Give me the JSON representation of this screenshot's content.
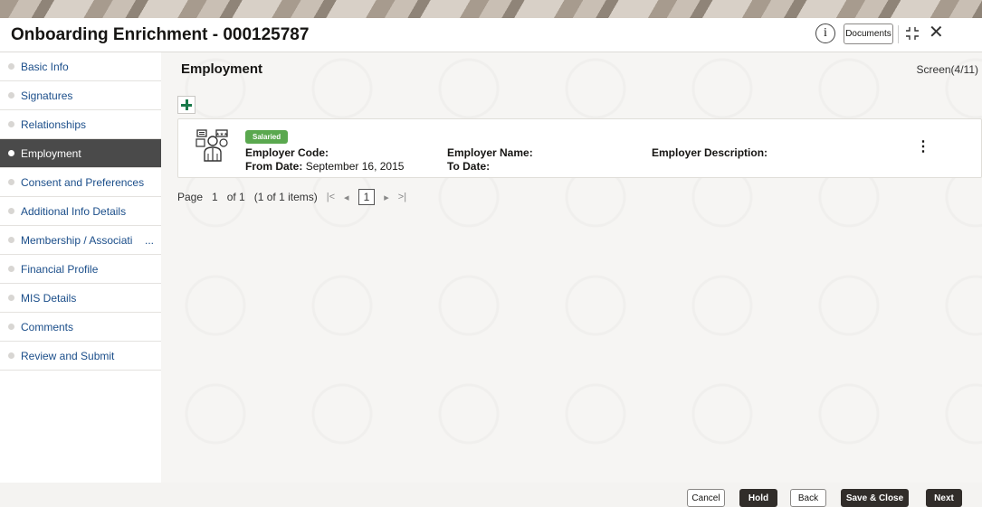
{
  "header": {
    "title": "Onboarding Enrichment - 000125787",
    "info_icon": "i",
    "documents_label": "Documents",
    "close_icon": "✕"
  },
  "sidebar": {
    "items": [
      {
        "label": "Basic Info"
      },
      {
        "label": "Signatures"
      },
      {
        "label": "Relationships"
      },
      {
        "label": "Employment",
        "active": true
      },
      {
        "label": "Consent and Preferences"
      },
      {
        "label": "Additional Info Details"
      },
      {
        "label": "Membership / Associati"
      },
      {
        "label": "Financial Profile"
      },
      {
        "label": "MIS Details"
      },
      {
        "label": "Comments"
      },
      {
        "label": "Review and Submit"
      }
    ],
    "truncation": "..."
  },
  "main": {
    "section_title": "Employment",
    "screen_count": "Screen(4/11)",
    "card": {
      "badge": "Salaried",
      "employer_code_label": "Employer Code:",
      "employer_code_value": "",
      "from_date_label": "From Date:",
      "from_date_value": "September 16, 2015",
      "employer_name_label": "Employer Name:",
      "employer_name_value": "",
      "to_date_label": "To Date:",
      "to_date_value": "",
      "employer_description_label": "Employer Description:",
      "employer_description_value": "",
      "menu_icon": "⋮"
    },
    "pager": {
      "page_label": "Page",
      "page_value": "1",
      "of_text": "of 1",
      "items_text": "(1 of 1 items)",
      "first_icon": "|<",
      "prev_icon": "◂",
      "current": "1",
      "next_icon": "▸",
      "last_icon": ">|"
    }
  },
  "footer": {
    "cancel": "Cancel",
    "hold": "Hold",
    "back": "Back",
    "save_close": "Save & Close",
    "next": "Next"
  },
  "colors": {
    "badge_green": "#5aa84f",
    "add_green": "#1a7a4a",
    "active_bg": "#4a4a4a",
    "dark_button": "#312d2a",
    "link_blue": "#1b4e8a"
  }
}
